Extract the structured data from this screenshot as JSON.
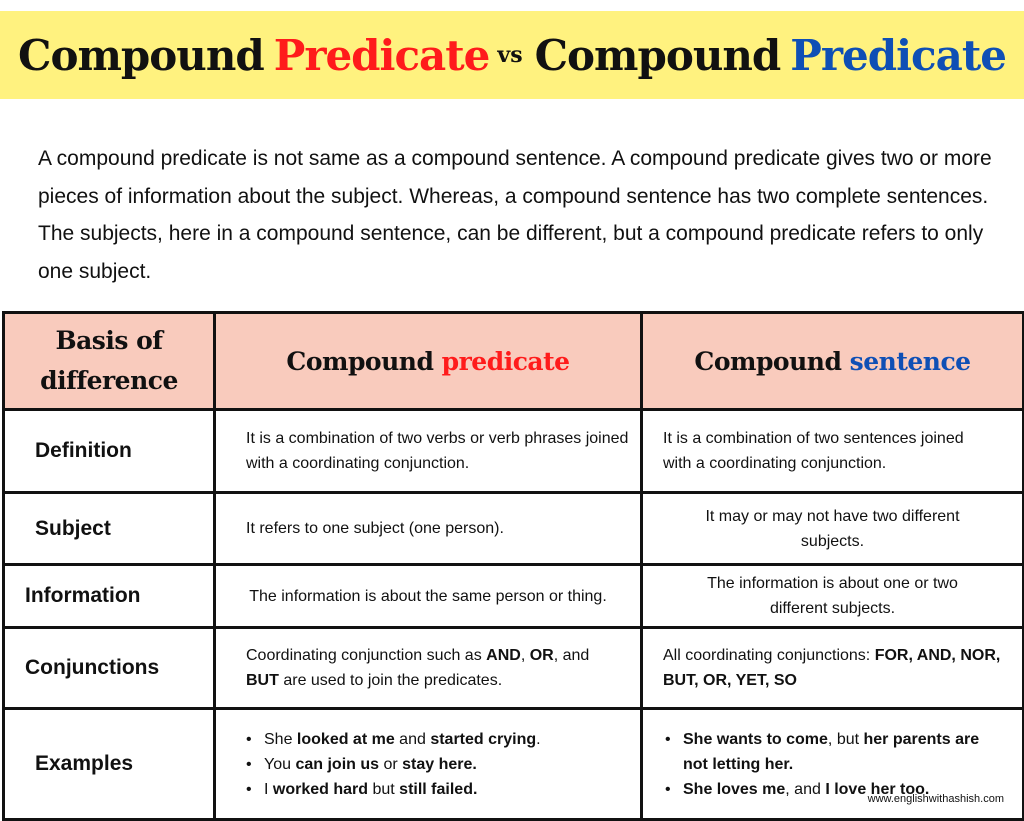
{
  "banner": {
    "part1": "Compound",
    "part2": "Predicate",
    "vs": "vs",
    "part3": "Compound",
    "part4": "Predicate",
    "colors": {
      "background": "#fff27f",
      "red": "#ff1b1b",
      "blue": "#0f4fb5"
    }
  },
  "intro": "A compound predicate is not same as a compound sentence. A compound predicate gives two or more pieces of information about the subject. Whereas, a compound sentence has two complete sentences. The subjects, here in a compound sentence, can be different, but a compound predicate refers to only one subject.",
  "table": {
    "header_bg": "#f9cbbd",
    "headers": {
      "basis_line1": "Basis of",
      "basis_line2": "difference",
      "predicate_a": "Compound",
      "predicate_b": "predicate",
      "sentence_a": "Compound",
      "sentence_b": "sentence"
    },
    "rows": [
      {
        "label": "Definition",
        "predicate": "It is a combination of two verbs or verb phrases joined with a coordinating conjunction.",
        "sentence": "It is a combination of two sentences joined with a coordinating conjunction."
      },
      {
        "label": "Subject",
        "predicate": "It refers to one subject (one person).",
        "sentence": "It may or may not have two different subjects."
      },
      {
        "label": "Information",
        "predicate": "The information is about the same person or thing.",
        "sentence": "The information is about one or two different subjects."
      },
      {
        "label": "Conjunctions",
        "predicate": {
          "t1": "Coordinating conjunction such as ",
          "b1": "AND",
          "t2": ", ",
          "b2": "OR",
          "t3": ", and ",
          "b3": "BUT",
          "t4": " are used to join the predicates."
        },
        "sentence": {
          "t1": "All coordinating conjunctions: ",
          "b1": "FOR, AND, NOR, BUT, OR, YET, SO"
        }
      },
      {
        "label": "Examples",
        "predicate_examples": [
          {
            "t1": "She ",
            "b1": "looked at me",
            "t2": " and ",
            "b2": "started crying",
            "t3": "."
          },
          {
            "t1": "You ",
            "b1": "can join us",
            "t2": " or ",
            "b2": "stay here.",
            "t3": ""
          },
          {
            "t1": "I ",
            "b1": "worked hard",
            "t2": " but ",
            "b2": "still failed.",
            "t3": ""
          }
        ],
        "sentence_examples": [
          {
            "b1": "She wants to come",
            "t1": ", but ",
            "b2": "her parents are not letting her.",
            "t2": ""
          },
          {
            "b1": "She loves me",
            "t1": ", and ",
            "b2": "I love her too.",
            "t2": ""
          }
        ]
      }
    ]
  },
  "watermark": "www.englishwithashish.com"
}
